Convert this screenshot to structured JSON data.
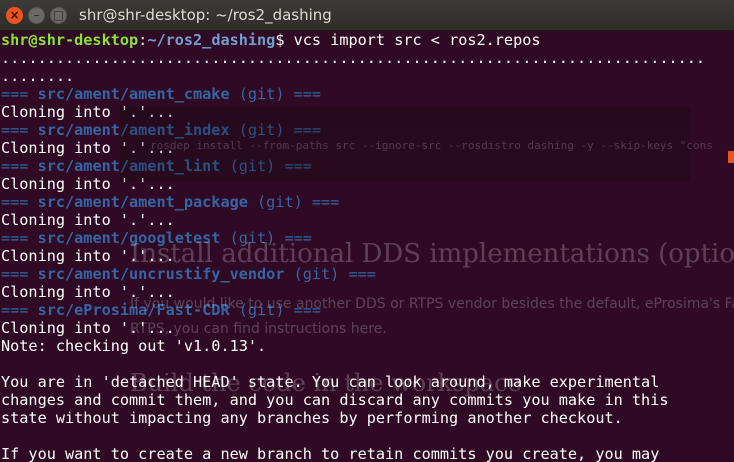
{
  "window": {
    "title": "shr@shr-desktop: ~/ros2_dashing",
    "close_glyph": "×",
    "minimize_glyph": "–",
    "maximize_glyph": "□"
  },
  "background_page": {
    "command_snippet": "rosdep install --from-paths src --ignore-src --rosdistro dashing -y --skip-keys \"cons",
    "heading_dds": "Install additional DDS implementations (optional)",
    "para_1": "If you would like to use another DDS or RTPS vendor besides the default, eProsima's Fast",
    "para_2": "RTPS, you can find instructions here.",
    "heading_build": "Build the code in the workspace"
  },
  "terminal": {
    "prompt_user": "shr@shr-desktop",
    "prompt_sep": ":",
    "prompt_path": "~/ros2_dashing",
    "prompt_symbol": "$ ",
    "command": "vcs import src < ros2.repos",
    "dots_line_1": ".............................................................................",
    "dots_line_2": "........",
    "repo_prefix": "=== ",
    "repo_suffix_vcs": " (git)",
    "repo_suffix_end": " ===",
    "repos": [
      {
        "name": "src/ament/ament_cmake",
        "output": "Cloning into '.'..."
      },
      {
        "name": "src/ament/ament_index",
        "output": "Cloning into '.'..."
      },
      {
        "name": "src/ament/ament_lint",
        "output": "Cloning into '.'..."
      },
      {
        "name": "src/ament/ament_package",
        "output": "Cloning into '.'..."
      },
      {
        "name": "src/ament/googletest",
        "output": "Cloning into '.'..."
      },
      {
        "name": "src/ament/uncrustify_vendor",
        "output": "Cloning into '.'..."
      },
      {
        "name": "src/eProsima/Fast-CDR",
        "output": "Cloning into '.'..."
      }
    ],
    "note_line": "Note: checking out 'v1.0.13'.",
    "blank": " ",
    "message_lines": [
      "You are in 'detached HEAD' state. You can look around, make experimental",
      "changes and commit them, and you can discard any commits you make in this",
      "state without impacting any branches by performing another checkout.",
      " ",
      "If you want to create a new branch to retain commits you create, you may"
    ]
  },
  "colors": {
    "terminal_bg": "#300a24",
    "prompt_user": "#8ae234",
    "prompt_path": "#729fcf",
    "repo_header": "#3465a4",
    "accent": "#e95420"
  }
}
